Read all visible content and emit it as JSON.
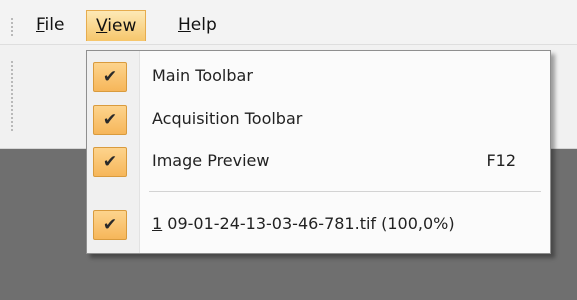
{
  "menubar": {
    "items": [
      {
        "mnemonic": "F",
        "rest": "ile"
      },
      {
        "mnemonic": "V",
        "rest": "iew"
      },
      {
        "mnemonic": "H",
        "rest": "elp"
      }
    ]
  },
  "view_menu": {
    "items": [
      {
        "label": "Main Toolbar",
        "checked": true,
        "check_icon": "checkmark-icon"
      },
      {
        "label": "Acquisition Toolbar",
        "checked": true,
        "check_icon": "checkmark-icon"
      },
      {
        "label": "Image Preview",
        "shortcut": "F12",
        "checked": true,
        "check_icon": "checkmark-icon"
      }
    ],
    "recent": {
      "mnemonic": "1",
      "rest": " 09-01-24-13-03-46-781.tif (100,0%)",
      "checked": true
    }
  },
  "colors": {
    "highlight": "#f6c66b",
    "workspace": "#6f6f6f",
    "menubar_bg": "#f3f3f3"
  }
}
